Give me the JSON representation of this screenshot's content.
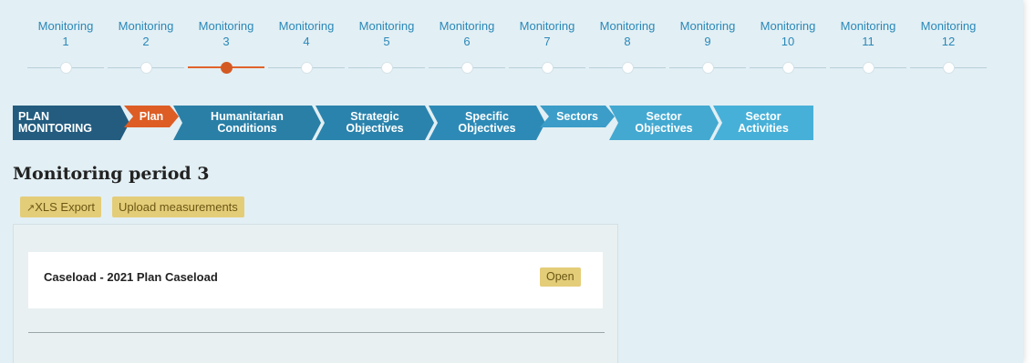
{
  "monitoring_tabs": [
    {
      "label": "Monitoring",
      "number": "1"
    },
    {
      "label": "Monitoring",
      "number": "2"
    },
    {
      "label": "Monitoring",
      "number": "3"
    },
    {
      "label": "Monitoring",
      "number": "4"
    },
    {
      "label": "Monitoring",
      "number": "5"
    },
    {
      "label": "Monitoring",
      "number": "6"
    },
    {
      "label": "Monitoring",
      "number": "7"
    },
    {
      "label": "Monitoring",
      "number": "8"
    },
    {
      "label": "Monitoring",
      "number": "9"
    },
    {
      "label": "Monitoring",
      "number": "10"
    },
    {
      "label": "Monitoring",
      "number": "11"
    },
    {
      "label": "Monitoring",
      "number": "12"
    }
  ],
  "active_monitoring_index": 2,
  "breadcrumbs": [
    {
      "line1": "PLAN",
      "line2": "MONITORING",
      "color": "#235c7f"
    },
    {
      "line1": "Plan",
      "line2": "",
      "color": "#dd5d25"
    },
    {
      "line1": "Humanitarian",
      "line2": "Conditions",
      "color": "#2a7fa6"
    },
    {
      "line1": "Strategic",
      "line2": "Objectives",
      "color": "#2a83ac"
    },
    {
      "line1": "Specific",
      "line2": "Objectives",
      "color": "#2d8ab6"
    },
    {
      "line1": "Sectors",
      "line2": "",
      "color": "#3b9dc8"
    },
    {
      "line1": "Sector",
      "line2": "Objectives",
      "color": "#43a9d1"
    },
    {
      "line1": "Sector",
      "line2": "Activities",
      "color": "#47b0d8"
    }
  ],
  "page_title": "Monitoring period 3",
  "actions": {
    "xls_export": "XLS Export",
    "xls_export_icon": "external-link-icon",
    "upload": "Upload measurements"
  },
  "caseload": {
    "title": "Caseload - 2021 Plan Caseload",
    "open_label": "Open"
  },
  "colors": {
    "accent_blue": "#2a88b8",
    "active_orange": "#d45a24",
    "button_yellow": "#e4cd79",
    "background": "#e2eff4"
  }
}
